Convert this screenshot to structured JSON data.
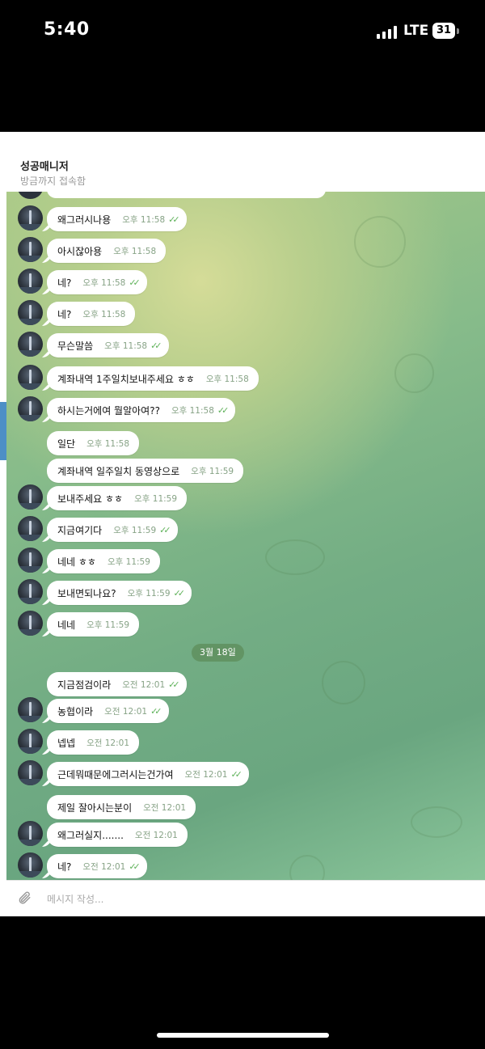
{
  "status": {
    "time": "5:40",
    "network": "LTE",
    "battery": "31"
  },
  "chat": {
    "title": "성공매니저",
    "subtitle": "방금까지 접속함",
    "messages": [
      {
        "text": "왜그러시나용",
        "time": "오후 11:58",
        "read": true
      },
      {
        "text": "아시잖아용",
        "time": "오후 11:58",
        "read": false
      },
      {
        "text": "네?",
        "time": "오후 11:58",
        "read": true
      },
      {
        "text": "네?",
        "time": "오후 11:58",
        "read": false
      },
      {
        "text": "무슨말씀",
        "time": "오후 11:58",
        "read": true
      },
      {
        "text": "계좌내역 1주일치보내주세요 ㅎㅎ",
        "time": "오후 11:58",
        "read": false
      },
      {
        "text": "하시는거에여 뭘알아여??",
        "time": "오후 11:58",
        "read": true
      },
      {
        "text": "일단",
        "time": "오후 11:58",
        "read": false
      },
      {
        "text": "계좌내역 일주일치 동영상으로",
        "time": "오후 11:59",
        "read": false
      },
      {
        "text": "보내주세요 ㅎㅎ",
        "time": "오후 11:59",
        "read": false
      },
      {
        "text": "지금여기다",
        "time": "오후 11:59",
        "read": true
      },
      {
        "text": "네네 ㅎㅎ",
        "time": "오후 11:59",
        "read": false
      },
      {
        "text": "보내면되나요?",
        "time": "오후 11:59",
        "read": true
      },
      {
        "text": "네네",
        "time": "오후 11:59",
        "read": false
      },
      {
        "text": "지금점검이라",
        "time": "오전 12:01",
        "read": true
      },
      {
        "text": "농협이라",
        "time": "오전 12:01",
        "read": true
      },
      {
        "text": "넵넵",
        "time": "오전 12:01",
        "read": false
      },
      {
        "text": "근데뭐때문에그러시는건가여",
        "time": "오전 12:01",
        "read": true
      },
      {
        "text": "제일 잘아시는분이",
        "time": "오전 12:01",
        "read": false
      },
      {
        "text": "왜그러실지.......",
        "time": "오전 12:01",
        "read": false
      },
      {
        "text": "네?",
        "time": "오전 12:01",
        "read": true
      }
    ],
    "date_separator": "3월 18일",
    "input_placeholder": "메시지 작성..."
  },
  "icons": {
    "attach": "paperclip-icon",
    "read": "double-check-icon"
  }
}
